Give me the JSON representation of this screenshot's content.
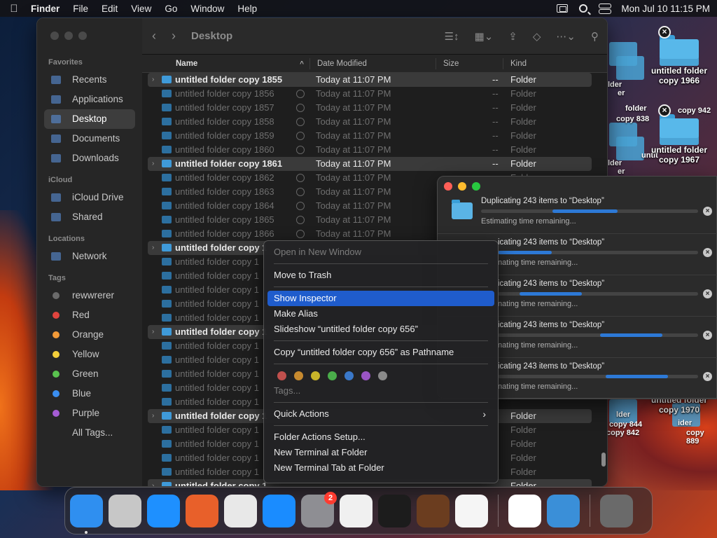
{
  "menubar": {
    "app_name": "Finder",
    "menus": [
      "File",
      "Edit",
      "View",
      "Go",
      "Window",
      "Help"
    ],
    "clock": "Mon Jul 10  11:15 PM"
  },
  "finder": {
    "title": "Desktop",
    "columns": {
      "name": "Name",
      "date": "Date Modified",
      "size": "Size",
      "kind": "Kind"
    },
    "sidebar": {
      "favorites_label": "Favorites",
      "favorites": [
        "Recents",
        "Applications",
        "Desktop",
        "Documents",
        "Downloads"
      ],
      "icloud_label": "iCloud",
      "icloud": [
        "iCloud Drive",
        "Shared"
      ],
      "locations_label": "Locations",
      "locations": [
        "Network"
      ],
      "tags_label": "Tags",
      "tags": [
        {
          "name": "rewwrerer",
          "color": "#6b6b6b"
        },
        {
          "name": "Red",
          "color": "#e0443e"
        },
        {
          "name": "Orange",
          "color": "#f29a38"
        },
        {
          "name": "Yellow",
          "color": "#f4cf3a"
        },
        {
          "name": "Green",
          "color": "#5ac34f"
        },
        {
          "name": "Blue",
          "color": "#3a8ef0"
        },
        {
          "name": "Purple",
          "color": "#a55cd4"
        },
        {
          "name": "All Tags...",
          "color": ""
        }
      ]
    },
    "rows": [
      {
        "name": "untitled folder copy 1855",
        "date": "Today at 11:07 PM",
        "size": "--",
        "kind": "Folder",
        "highlight": true
      },
      {
        "name": "untitled folder copy 1856",
        "date": "Today at 11:07 PM",
        "size": "--",
        "kind": "Folder"
      },
      {
        "name": "untitled folder copy 1857",
        "date": "Today at 11:07 PM",
        "size": "--",
        "kind": "Folder"
      },
      {
        "name": "untitled folder copy 1858",
        "date": "Today at 11:07 PM",
        "size": "--",
        "kind": "Folder"
      },
      {
        "name": "untitled folder copy 1859",
        "date": "Today at 11:07 PM",
        "size": "--",
        "kind": "Folder"
      },
      {
        "name": "untitled folder copy 1860",
        "date": "Today at 11:07 PM",
        "size": "--",
        "kind": "Folder"
      },
      {
        "name": "untitled folder copy 1861",
        "date": "Today at 11:07 PM",
        "size": "--",
        "kind": "Folder",
        "highlight": true
      },
      {
        "name": "untitled folder copy 1862",
        "date": "Today at 11:07 PM",
        "size": "--",
        "kind": "Folder"
      },
      {
        "name": "untitled folder copy 1863",
        "date": "Today at 11:07 PM",
        "size": "--",
        "kind": "Folder"
      },
      {
        "name": "untitled folder copy 1864",
        "date": "Today at 11:07 PM",
        "size": "--",
        "kind": "Folder"
      },
      {
        "name": "untitled folder copy 1865",
        "date": "Today at 11:07 PM",
        "size": "--",
        "kind": "Folder"
      },
      {
        "name": "untitled folder copy 1866",
        "date": "Today at 11:07 PM",
        "size": "--",
        "kind": "Folder"
      },
      {
        "name": "untitled folder copy 1",
        "date": "",
        "size": "",
        "kind": "",
        "highlight": true
      },
      {
        "name": "untitled folder copy 1",
        "date": "",
        "size": "",
        "kind": ""
      },
      {
        "name": "untitled folder copy 1",
        "date": "",
        "size": "",
        "kind": ""
      },
      {
        "name": "untitled folder copy 1",
        "date": "",
        "size": "",
        "kind": ""
      },
      {
        "name": "untitled folder copy 1",
        "date": "",
        "size": "",
        "kind": ""
      },
      {
        "name": "untitled folder copy 1",
        "date": "",
        "size": "",
        "kind": ""
      },
      {
        "name": "untitled folder copy 1",
        "date": "",
        "size": "",
        "kind": "",
        "highlight": true
      },
      {
        "name": "untitled folder copy 1",
        "date": "",
        "size": "",
        "kind": ""
      },
      {
        "name": "untitled folder copy 1",
        "date": "",
        "size": "",
        "kind": ""
      },
      {
        "name": "untitled folder copy 1",
        "date": "",
        "size": "",
        "kind": ""
      },
      {
        "name": "untitled folder copy 1",
        "date": "",
        "size": "",
        "kind": ""
      },
      {
        "name": "untitled folder copy 1",
        "date": "",
        "size": "",
        "kind": ""
      },
      {
        "name": "untitled folder copy 1",
        "date": "",
        "size": "",
        "kind": "Folder",
        "highlight": true
      },
      {
        "name": "untitled folder copy 1",
        "date": "",
        "size": "",
        "kind": "Folder"
      },
      {
        "name": "untitled folder copy 1",
        "date": "",
        "size": "",
        "kind": "Folder"
      },
      {
        "name": "untitled folder copy 1",
        "date": "",
        "size": "",
        "kind": "Folder"
      },
      {
        "name": "untitled folder copy 1",
        "date": "",
        "size": "",
        "kind": "Folder"
      },
      {
        "name": "untitled folder copy 1",
        "date": "",
        "size": "",
        "kind": "Folder",
        "highlight": true
      }
    ]
  },
  "desktop": {
    "icons": [
      {
        "label1": "untitled folder",
        "label2": "copy 1966"
      },
      {
        "label1": "untitled folder",
        "label2": "copy 1967"
      },
      {
        "label1": "untitled folder",
        "label2": "copy 1970"
      }
    ],
    "ghosts": [
      "lder",
      "er",
      "folder",
      "copy 838",
      "copy 942",
      "lder",
      "er",
      "untit",
      "lder",
      "ider",
      "copy 844",
      "copy 842",
      "copy 889"
    ]
  },
  "copy_window": {
    "items": [
      {
        "title": "Duplicating 243 items to “Desktop”",
        "sub": "Estimating time remaining...",
        "progress_start": 0.33,
        "progress_end": 0.63
      },
      {
        "title": "icating 243 items to “Desktop”",
        "sub": "nating time remaining...",
        "progress_start": 0.0,
        "progress_end": 0.27
      },
      {
        "title": "icating 243 items to “Desktop”",
        "sub": "nating time remaining...",
        "progress_start": 0.11,
        "progress_end": 0.42
      },
      {
        "title": "icating 243 items to “Desktop”",
        "sub": "nating time remaining...",
        "progress_start": 0.51,
        "progress_end": 0.82
      },
      {
        "title": "icating 243 items to “Desktop”",
        "sub": "nating time remaining...",
        "progress_start": 0.54,
        "progress_end": 0.85
      }
    ]
  },
  "context_menu": {
    "open_new_window": "Open in New Window",
    "move_to_trash": "Move to Trash",
    "show_inspector": "Show Inspector",
    "make_alias": "Make Alias",
    "slideshow": "Slideshow “untitled folder copy 656”",
    "copy_pathname": "Copy “untitled folder copy 656” as Pathname",
    "tag_colors": [
      "#c0504d",
      "#c78a2f",
      "#c8b42a",
      "#4aad4a",
      "#3a78c9",
      "#9a55c4",
      "#8a8a8a"
    ],
    "tags_placeholder": "Tags...",
    "quick_actions": "Quick Actions",
    "folder_actions": "Folder Actions Setup...",
    "new_terminal": "New Terminal at Folder",
    "new_terminal_tab": "New Terminal Tab at Folder"
  },
  "dock": {
    "apps": [
      {
        "name": "finder-icon",
        "color": "#2f8ff0",
        "running": true
      },
      {
        "name": "launchpad-icon",
        "color": "#c7c7c7"
      },
      {
        "name": "safari-icon",
        "color": "#1e90ff"
      },
      {
        "name": "firefox-icon",
        "color": "#e8602a"
      },
      {
        "name": "chrome-icon",
        "color": "#e8e8e8"
      },
      {
        "name": "app-store-icon",
        "color": "#1a8cff"
      },
      {
        "name": "system-settings-icon",
        "color": "#8e8e93",
        "badge": "2"
      },
      {
        "name": "textedit-icon",
        "color": "#f0f0f0"
      },
      {
        "name": "terminal-icon",
        "color": "#1c1c1c"
      },
      {
        "name": "garageband-icon",
        "color": "#6b3d1f"
      },
      {
        "name": "vscode-icon",
        "color": "#f5f5f5"
      },
      {
        "name": "visual-studio-icon",
        "color": "#ffffff"
      },
      {
        "name": "weather-icon",
        "color": "#3a8fd8"
      },
      {
        "name": "trash-icon",
        "color": "#6a6a6a"
      }
    ]
  }
}
